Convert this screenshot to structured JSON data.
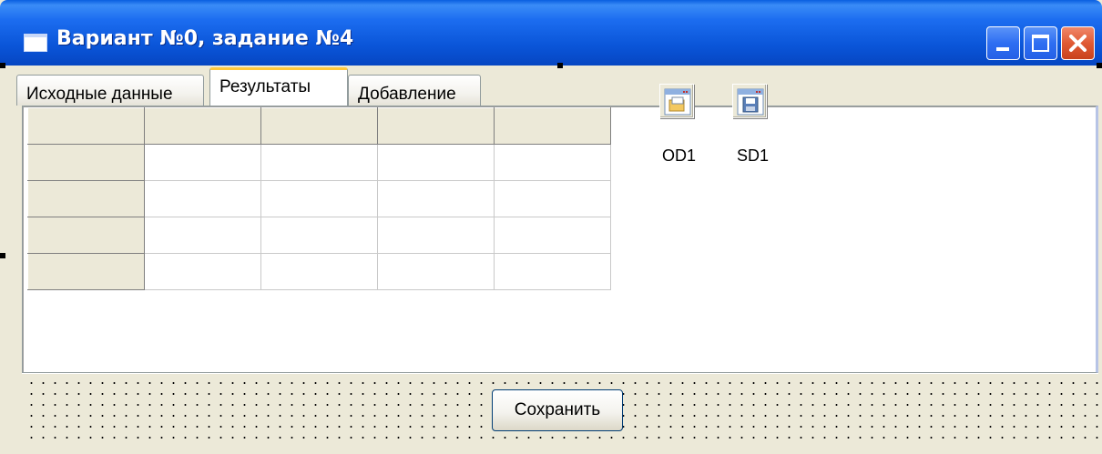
{
  "window": {
    "title": "Вариант №0, задание №4",
    "controls": [
      "minimize-icon",
      "maximize-icon",
      "close-icon"
    ]
  },
  "tabs": [
    {
      "label": "Исходные данные",
      "active": false
    },
    {
      "label": "Результаты",
      "active": true
    },
    {
      "label": "Добавление",
      "active": false
    }
  ],
  "grid": {
    "rows": 5,
    "cols": 5,
    "fixed_rows": 1,
    "fixed_cols": 1,
    "cells": []
  },
  "components": [
    {
      "name": "OD1",
      "icon": "open-dialog-icon"
    },
    {
      "name": "SD1",
      "icon": "save-dialog-icon"
    }
  ],
  "actions": {
    "save_label": "Сохранить"
  },
  "colors": {
    "titlebar": "#0a55d8",
    "form_background": "#ece9d8",
    "active_tab_accent": "#ffc83c"
  }
}
